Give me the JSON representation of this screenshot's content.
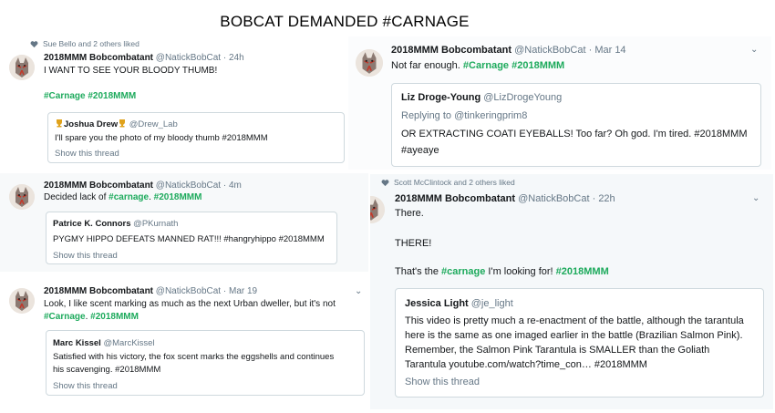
{
  "page_title": "BOBCAT DEMANDED #CARNAGE",
  "tweet1": {
    "social": "Sue Bello and 2 others liked",
    "name": "2018MMM Bobcombatant",
    "handle": "@NatickBobCat",
    "dot": "·",
    "time": "24h",
    "text": "I WANT TO SEE YOUR BLOODY THUMB!",
    "tag1": "#Carnage",
    "tag2": "#2018MMM",
    "quote": {
      "name": "Joshua Drew",
      "handle": "@Drew_Lab",
      "text": "I'll spare you the photo of my bloody thumb #2018MMM",
      "show": "Show this thread"
    }
  },
  "tweet2": {
    "name": "2018MMM Bobcombatant",
    "handle": "@NatickBobCat",
    "dot": "·",
    "time": "Mar 14",
    "text": "Not far enough.",
    "tag1": "#Carnage",
    "tag2": "#2018MMM",
    "quote": {
      "name": "Liz Droge-Young",
      "handle": "@LizDrogeYoung",
      "reply": "Replying to @tinkeringprim8",
      "line1": "OR EXTRACTING COATI EYEBALLS! Too far? Oh god. I'm tired. #2018MMM",
      "line2": "#ayeaye"
    }
  },
  "tweet3": {
    "name": "2018MMM Bobcombatant",
    "handle": "@NatickBobCat",
    "dot": "·",
    "time": "4m",
    "text_pre": "Decided lack of",
    "tag1": "#carnage",
    "tag_sep": ".",
    "tag2": "#2018MMM",
    "quote": {
      "name": "Patrice K. Connors",
      "handle": "@PKurnath",
      "text": "PYGMY HIPPO DEFEATS MANNED RAT!!! #hangryhippo #2018MMM",
      "show": "Show this thread"
    }
  },
  "tweet4": {
    "name": "2018MMM Bobcombatant",
    "handle": "@NatickBobCat",
    "dot": "·",
    "time": "Mar 19",
    "line1": "Look, I like scent marking as much as the next Urban dweller, but it's not",
    "tag1": "#Carnage",
    "tag_sep": ".",
    "tag2": "#2018MMM",
    "quote": {
      "name": "Marc Kissel",
      "handle": "@MarcKissel",
      "line1": "Satisfied with his victory, the fox scent marks the eggshells and continues",
      "line2": "his scavenging. #2018MMM",
      "show": "Show this thread"
    }
  },
  "tweet5": {
    "social": "Scott McClintock and 2 others liked",
    "name": "2018MMM Bobcombatant",
    "handle": "@NatickBobCat",
    "dot": "·",
    "time": "22h",
    "line1": "There.",
    "line2": "THERE!",
    "line3_pre": "That's the",
    "tag1": "#carnage",
    "line3_mid": "I'm looking for!",
    "tag2": "#2018MMM",
    "quote": {
      "name": "Jessica Light",
      "handle": "@je_light",
      "line1": "This video is pretty much a re-enactment of the battle, although the tarantula",
      "line2": "here is the same as one imaged earlier in the battle (Brazilian Salmon Pink).",
      "line3": "Remember, the Salmon Pink Tarantula is SMALLER than the Goliath",
      "line4": "Tarantula youtube.com/watch?time_con… #2018MMM",
      "show": "Show this thread"
    }
  },
  "icons": {
    "avatar": "bobcat-avatar-icon",
    "heart": "heart-icon",
    "chevron": "chevron-down-icon",
    "trophy": "trophy-icon"
  },
  "colors": {
    "hashtag": "#1daa5c",
    "secondary_text": "#657786",
    "border": "#cfd9de"
  }
}
